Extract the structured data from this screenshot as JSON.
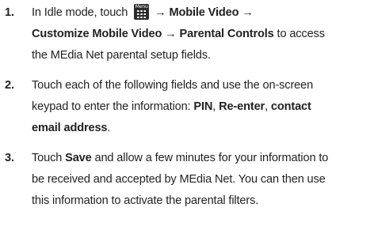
{
  "steps": [
    {
      "number": "1.",
      "line1": {
        "pre": "In Idle mode, touch ",
        "icon": "menu-key-icon",
        "icon_label": "Menu",
        "arrow1": " → ",
        "b1": "Mobile Video",
        "arrow2": " →"
      },
      "line2": {
        "b1": "Customize Mobile Video",
        "arrow": " → ",
        "b2": "Parental Controls",
        "post": " to access"
      },
      "line3": {
        "text": "the MEdia Net parental setup fields."
      }
    },
    {
      "number": "2.",
      "line1": {
        "text": "Touch each of the following fields and use the on-screen"
      },
      "line2": {
        "pre": "keypad to enter the information: ",
        "b1": "PIN",
        "sep1": ", ",
        "b2": "Re-enter",
        "sep2": ", ",
        "b3": "contact"
      },
      "line3": {
        "b1": "email address",
        "post": "."
      }
    },
    {
      "number": "3.",
      "line1": {
        "pre": "Touch ",
        "b1": "Save",
        "post": " and allow a few minutes for your information to"
      },
      "line2": {
        "text": "be received and accepted by MEdia Net. You can then use"
      },
      "line3": {
        "text": "this information to activate the parental filters."
      }
    }
  ]
}
